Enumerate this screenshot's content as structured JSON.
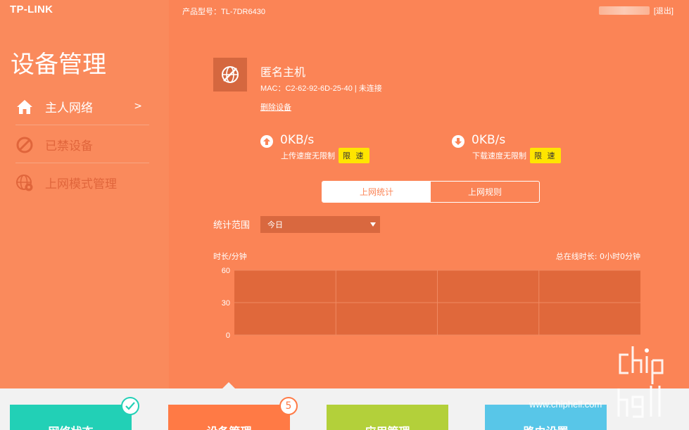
{
  "brand": {
    "logo": "TP-LINK"
  },
  "header": {
    "model_text": "产品型号：TL-7DR6430",
    "logout": "[退出]"
  },
  "sidebar": {
    "title": "设备管理",
    "items": [
      {
        "label": "主人网络",
        "icon": "home-icon",
        "active": true,
        "chevron": ">"
      },
      {
        "label": "已禁设备",
        "icon": "ban-icon",
        "active": false
      },
      {
        "label": "上网模式管理",
        "icon": "globe-gear-icon",
        "active": false
      }
    ]
  },
  "device": {
    "icon": "no-network-globe-icon",
    "name": "匿名主机",
    "mac": "MAC：C2-62-92-6D-25-40 | 未连接",
    "remove_label": "删除设备"
  },
  "upload": {
    "value": "0KB/s",
    "label": "上传速度无限制",
    "limit_btn": "限 速"
  },
  "download": {
    "value": "0KB/s",
    "label": "下载速度无限制",
    "limit_btn": "限 速"
  },
  "tabs": [
    {
      "label": "上网统计",
      "selected": true
    },
    {
      "label": "上网规则",
      "selected": false
    }
  ],
  "stats": {
    "range_label": "统计范围",
    "range_value": "今日"
  },
  "chart_data": {
    "type": "bar",
    "ylabel": "时长/分钟",
    "total": "总在线时长: 0小时0分钟",
    "yticks": [
      60,
      30,
      0
    ],
    "ylim": [
      0,
      60
    ],
    "categories": [],
    "values": [],
    "grid": true
  },
  "bottom_tiles": [
    {
      "label": "网络状态",
      "color": "#22d0b6",
      "badge": "check-icon"
    },
    {
      "label": "设备管理",
      "color": "#ff7a45",
      "badge": "5"
    },
    {
      "label": "应用管理",
      "color": "#b3d03a",
      "badge": ""
    },
    {
      "label": "路由设置",
      "color": "#58c6e8",
      "badge": ""
    }
  ],
  "watermark": {
    "url": "www.chiphell.com"
  },
  "colors": {
    "sidebar": "#fa8a5c",
    "main": "#fb8456",
    "accent_yellow": "#ffe500"
  }
}
